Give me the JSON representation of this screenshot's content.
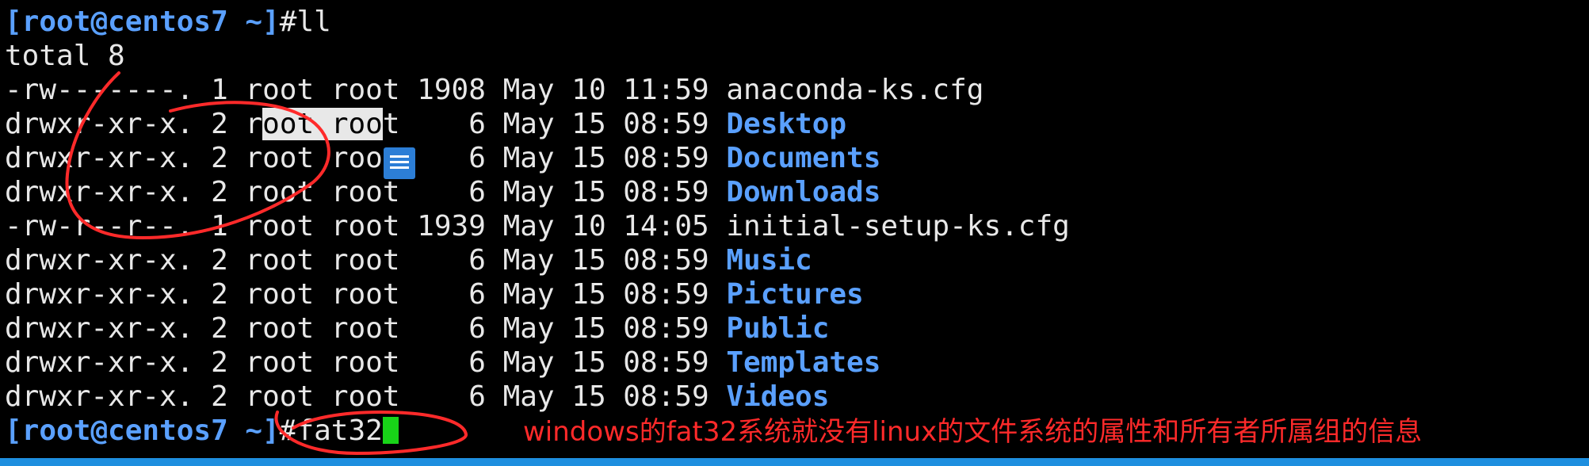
{
  "terminal": {
    "prompt": "[root@centos7 ~]",
    "lines": [
      {
        "kind": "prompt",
        "prompt": "[root@centos7 ~]",
        "cmd": "#ll"
      },
      {
        "kind": "text",
        "text": "total 8"
      },
      {
        "kind": "entry",
        "perm": "-rw-------.",
        "links": "1",
        "owner": "root",
        "group": "root",
        "size": "1908",
        "date": "May 10 11:59",
        "name": "anaconda-ks.cfg",
        "is_dir": false
      },
      {
        "kind": "entry",
        "perm": "drwxr-xr-x.",
        "links": "2",
        "owner": "root",
        "group": "root",
        "size": "6",
        "date": "May 15 08:59",
        "name": "Desktop",
        "is_dir": true
      },
      {
        "kind": "entry",
        "perm": "drwxr-xr-x.",
        "links": "2",
        "owner": "root",
        "group": "root",
        "size": "6",
        "date": "May 15 08:59",
        "name": "Documents",
        "is_dir": true
      },
      {
        "kind": "entry",
        "perm": "drwxr-xr-x.",
        "links": "2",
        "owner": "root",
        "group": "root",
        "size": "6",
        "date": "May 15 08:59",
        "name": "Downloads",
        "is_dir": true
      },
      {
        "kind": "entry",
        "perm": "-rw-r--r--.",
        "links": "1",
        "owner": "root",
        "group": "root",
        "size": "1939",
        "date": "May 10 14:05",
        "name": "initial-setup-ks.cfg",
        "is_dir": false
      },
      {
        "kind": "entry",
        "perm": "drwxr-xr-x.",
        "links": "2",
        "owner": "root",
        "group": "root",
        "size": "6",
        "date": "May 15 08:59",
        "name": "Music",
        "is_dir": true
      },
      {
        "kind": "entry",
        "perm": "drwxr-xr-x.",
        "links": "2",
        "owner": "root",
        "group": "root",
        "size": "6",
        "date": "May 15 08:59",
        "name": "Pictures",
        "is_dir": true
      },
      {
        "kind": "entry",
        "perm": "drwxr-xr-x.",
        "links": "2",
        "owner": "root",
        "group": "root",
        "size": "6",
        "date": "May 15 08:59",
        "name": "Public",
        "is_dir": true
      },
      {
        "kind": "entry",
        "perm": "drwxr-xr-x.",
        "links": "2",
        "owner": "root",
        "group": "root",
        "size": "6",
        "date": "May 15 08:59",
        "name": "Templates",
        "is_dir": true
      },
      {
        "kind": "entry",
        "perm": "drwxr-xr-x.",
        "links": "2",
        "owner": "root",
        "group": "root",
        "size": "6",
        "date": "May 15 08:59",
        "name": "Videos",
        "is_dir": true
      },
      {
        "kind": "prompt",
        "prompt": "[root@centos7 ~]",
        "cmd": "#fat32",
        "cursor": true
      }
    ]
  },
  "annotation": {
    "note": "windows的fat32系统就没有linux的文件系统的属性和所有者所属组的信息",
    "ink_color": "#ff2a2a"
  },
  "colors": {
    "background": "#000000",
    "text": "#e8e8e8",
    "directory": "#5aa0ff",
    "cursor": "#18d418",
    "bottom_bar": "#1e8fdf"
  },
  "icons": {
    "ime_icon": "ime-icon"
  }
}
